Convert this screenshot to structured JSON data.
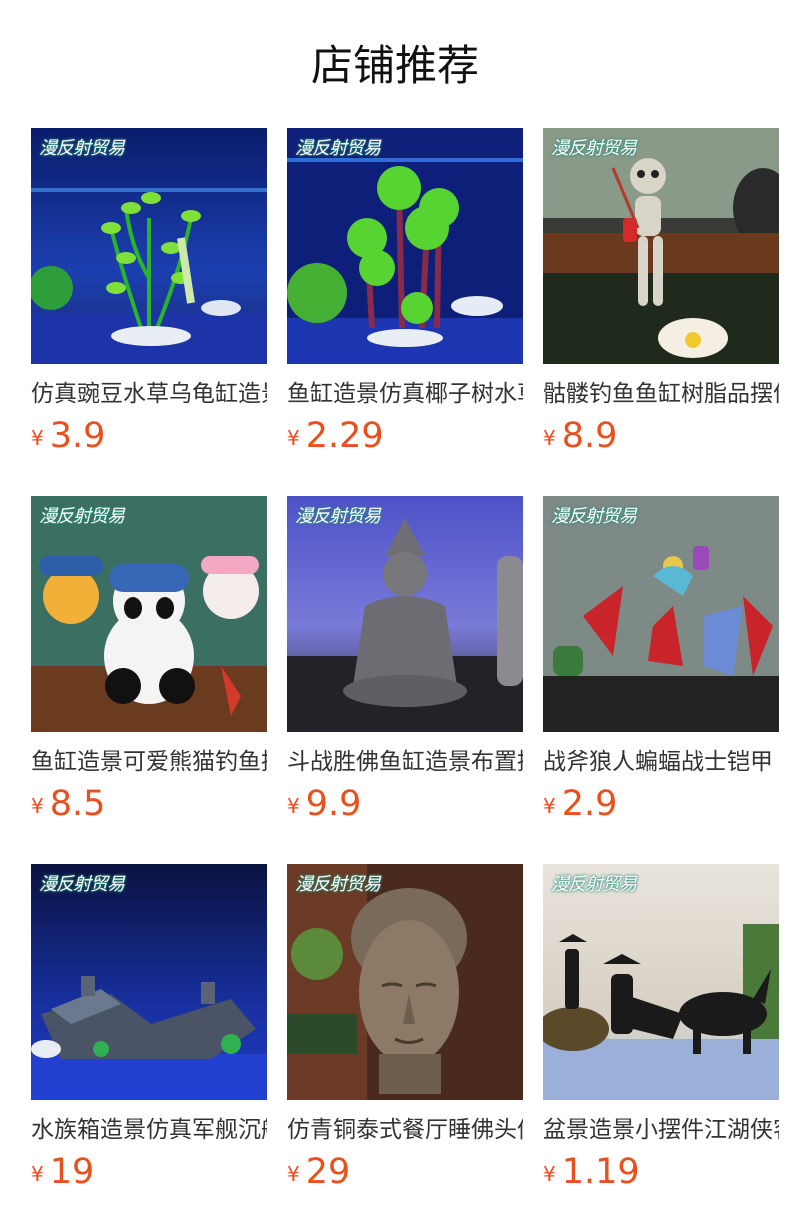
{
  "section_title": "店铺推荐",
  "watermark": "漫反射贸易",
  "currency": "¥",
  "accent_color": "#e8501c",
  "products": [
    {
      "name": "仿真豌豆水草乌龟缸造景",
      "price": "3.9",
      "image": "aquarium-plant-photo"
    },
    {
      "name": "鱼缸造景仿真椰子树水草",
      "price": "2.29",
      "image": "palm-tree-plant-photo"
    },
    {
      "name": "骷髅钓鱼鱼缸树脂品摆件",
      "price": "8.9",
      "image": "skeleton-fishing-photo"
    },
    {
      "name": "鱼缸造景可爱熊猫钓鱼摆件",
      "price": "8.5",
      "image": "panda-fishing-photo"
    },
    {
      "name": "斗战胜佛鱼缸造景布置摆件",
      "price": "9.9",
      "image": "buddha-statue-photo"
    },
    {
      "name": "战斧狼人蝙蝠战士铠甲",
      "price": "2.9",
      "image": "dragon-figures-photo"
    },
    {
      "name": "水族箱造景仿真军舰沉船",
      "price": "19",
      "image": "sunken-warship-photo"
    },
    {
      "name": "仿青铜泰式餐厅睡佛头像",
      "price": "29",
      "image": "buddha-head-photo"
    },
    {
      "name": "盆景造景小摆件江湖侠客",
      "price": "1.19",
      "image": "swordsman-horse-photo"
    }
  ]
}
